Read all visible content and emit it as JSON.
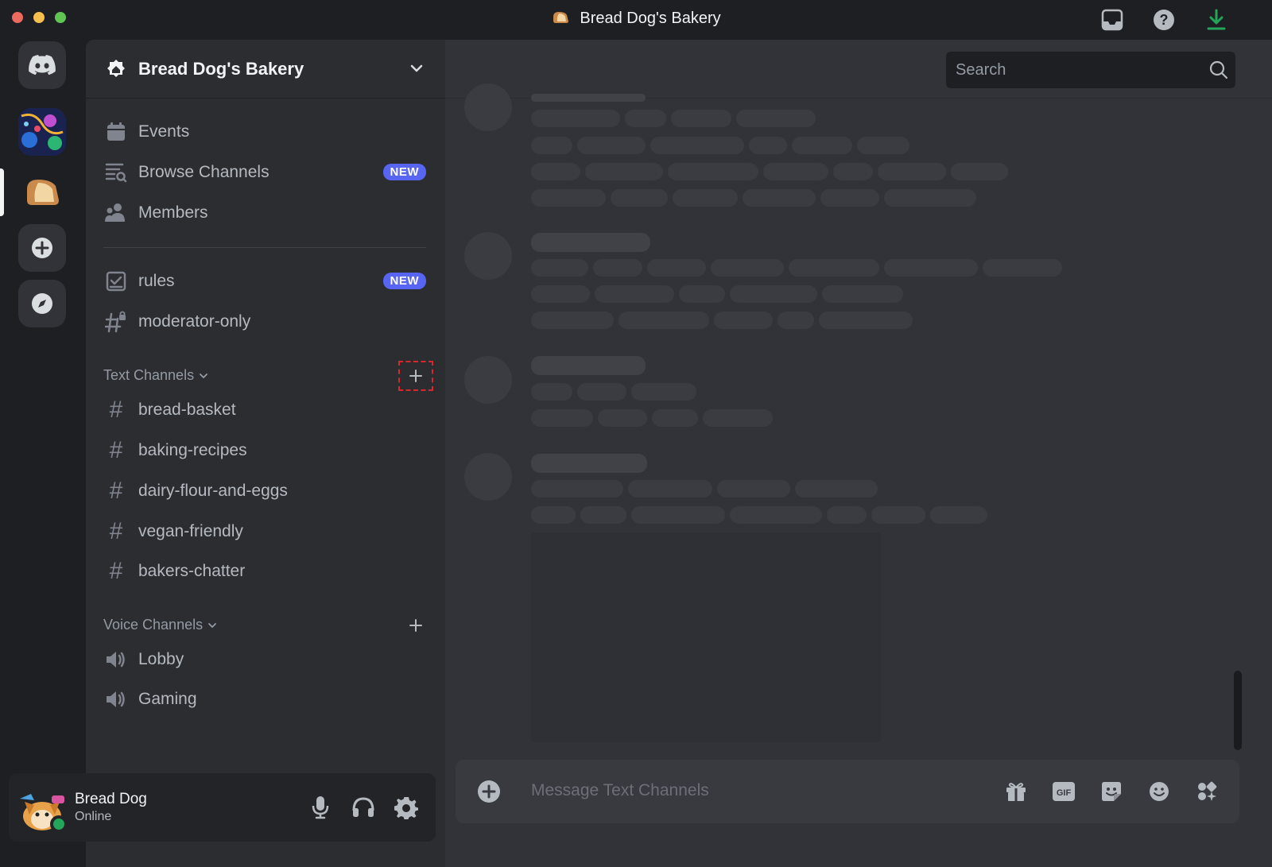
{
  "window": {
    "title": "Bread Dog's Bakery"
  },
  "server": {
    "name": "Bread Dog's Bakery"
  },
  "sidebar": {
    "top_items": [
      {
        "label": "Events",
        "icon": "calendar-icon"
      },
      {
        "label": "Browse Channels",
        "icon": "browse-channels-icon",
        "badge": "NEW"
      },
      {
        "label": "Members",
        "icon": "members-icon"
      }
    ],
    "special_channels": [
      {
        "label": "rules",
        "icon": "rules-icon",
        "badge": "NEW"
      },
      {
        "label": "moderator-only",
        "icon": "locked-hash-icon"
      }
    ],
    "text_category": {
      "label": "Text Channels",
      "channels": [
        "bread-basket",
        "baking-recipes",
        "dairy-flour-and-eggs",
        "vegan-friendly",
        "bakers-chatter"
      ]
    },
    "voice_category": {
      "label": "Voice Channels",
      "channels": [
        "Lobby",
        "Gaming"
      ]
    }
  },
  "user": {
    "name": "Bread Dog",
    "status": "Online"
  },
  "main": {
    "search_placeholder": "Search",
    "composer_placeholder": "Message Text Channels"
  },
  "colors": {
    "accent": "#5865f2",
    "online": "#23a55a",
    "download": "#23a55a",
    "focus_outline": "#d9272e"
  }
}
